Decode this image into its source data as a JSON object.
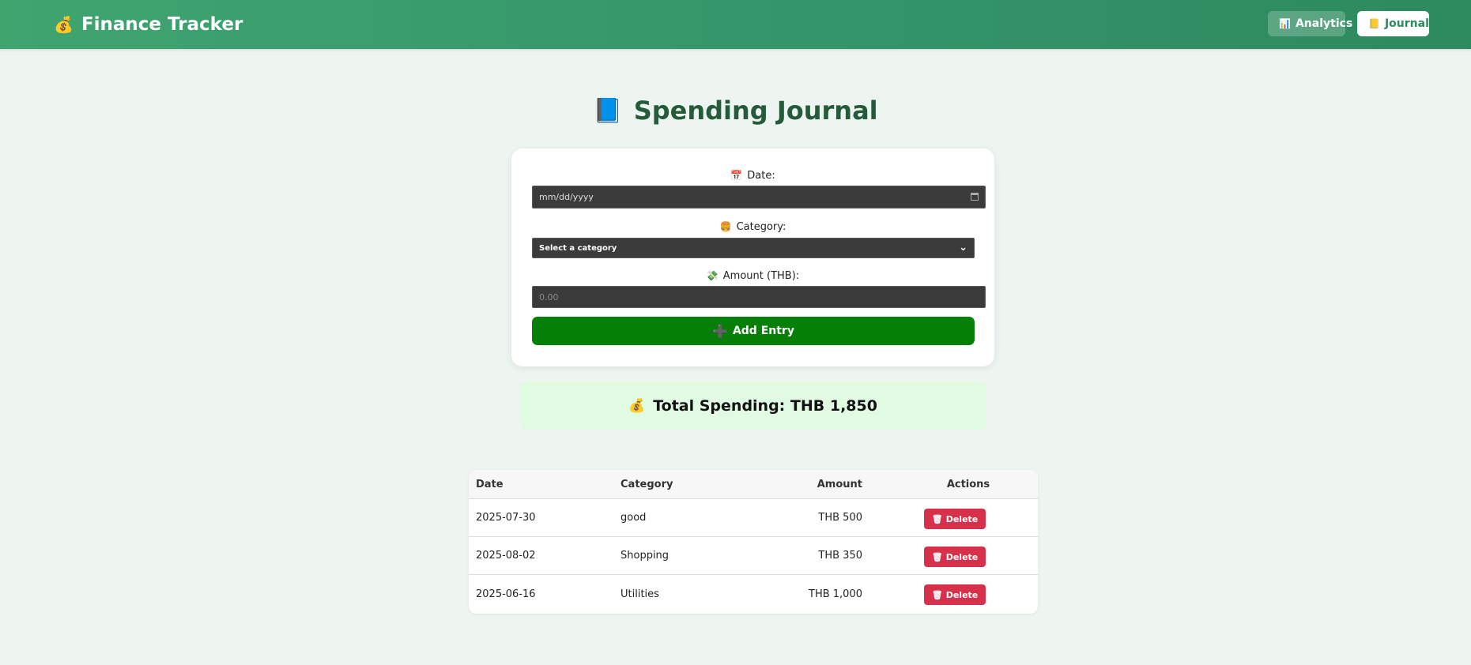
{
  "header": {
    "brand_icon": "money-bag-icon",
    "brand_emoji": "💰",
    "brand_title": "Finance Tracker",
    "nav": [
      {
        "icon": "chart-icon",
        "emoji": "📊",
        "label": "Analytics"
      },
      {
        "icon": "notepad-icon",
        "emoji": "📒",
        "label": "Journal"
      }
    ]
  },
  "page": {
    "title_emoji": "📘",
    "title": "Spending Journal"
  },
  "form": {
    "date_label": "Date:",
    "date_emoji": "📅",
    "date_placeholder": "mm/dd/yyyy",
    "category_label": "Category:",
    "category_emoji": "🍔",
    "category_selected": "Select a category",
    "amount_label": "Amount (THB):",
    "amount_emoji": "💸",
    "amount_placeholder": "0.00",
    "add_label": "Add Entry",
    "add_emoji": "➕"
  },
  "total": {
    "emoji": "💰",
    "text": "Total Spending: THB 1,850"
  },
  "table": {
    "headers": [
      "Date",
      "Category",
      "Amount",
      "Actions"
    ],
    "rows": [
      {
        "date": "2025-07-30",
        "category": "good",
        "amount": "THB 500",
        "action": "Delete"
      },
      {
        "date": "2025-08-02",
        "category": "Shopping",
        "amount": "THB 350",
        "action": "Delete"
      },
      {
        "date": "2025-06-16",
        "category": "Utilities",
        "amount": "THB 1,000",
        "action": "Delete"
      }
    ],
    "delete_emoji": "🗑"
  },
  "colors": {
    "header_bg": "#3fa56f",
    "title": "#245b3a",
    "add_button": "#057f05",
    "delete_button": "#d7304a",
    "total_bg": "#e0fbe2"
  }
}
